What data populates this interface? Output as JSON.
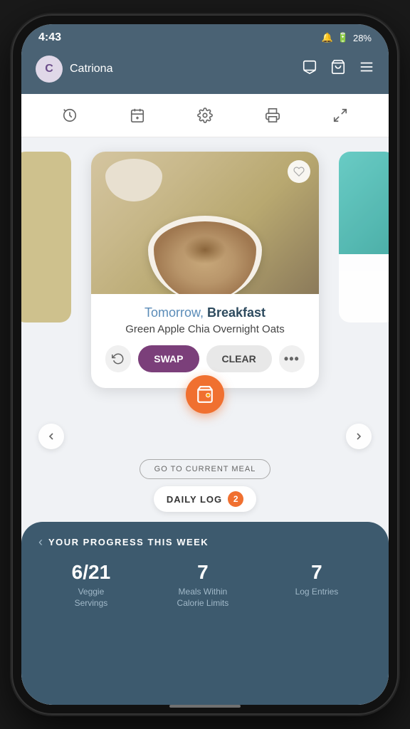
{
  "status": {
    "time": "4:43",
    "battery": "28%",
    "battery_icon": "battery-icon",
    "signal_icon": "signal-icon"
  },
  "header": {
    "avatar_letter": "C",
    "user_name": "Catriona",
    "message_icon": "message-icon",
    "basket_icon": "basket-icon",
    "menu_icon": "menu-icon"
  },
  "toolbar": {
    "icons": [
      "history-icon",
      "calendar-add-icon",
      "settings-icon",
      "print-icon",
      "expand-icon"
    ]
  },
  "meal_card": {
    "timing": "Tomorrow, ",
    "timing_bold": "Breakfast",
    "meal_name": "Green Apple Chia Overnight Oats",
    "swap_label": "SWAP",
    "clear_label": "CLEAR",
    "go_current_label": "GO TO CURRENT MEAL"
  },
  "daily_log": {
    "label": "DAILY LOG",
    "count": "2"
  },
  "progress": {
    "title": "YOUR PROGRESS THIS WEEK",
    "stats": [
      {
        "value": "6/21",
        "label": "Veggie\nServings"
      },
      {
        "value": "7",
        "label": "Meals Within\nCalorie Limits"
      },
      {
        "value": "7",
        "label": "Log Entries"
      }
    ]
  }
}
